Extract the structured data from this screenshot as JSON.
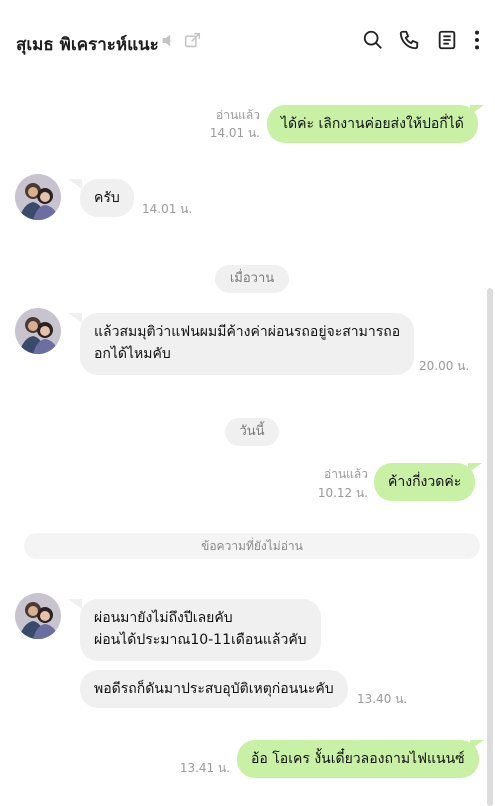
{
  "header": {
    "title": "สุเมธ พิเคราะห์แนะ"
  },
  "messages": {
    "m1": {
      "text": "ได้ค่ะ เลิกงานค่อยส่งให้ปอกี่ได้",
      "status": "อ่านแล้ว",
      "time": "14.01 น."
    },
    "m2": {
      "text": "ครับ",
      "time": "14.01 น."
    },
    "m3": {
      "text_line1": "แล้วสมมุติว่าแฟนผมมีค้างค่าผ่อนรถอยู่จะสามารถอ",
      "text_line2": "อกได้ไหมคับ",
      "time": "20.00 น."
    },
    "m4": {
      "text": "ค้างกี่งวดค่ะ",
      "status": "อ่านแล้ว",
      "time": "10.12 น."
    },
    "m5": {
      "text_line1": "ผ่อนมายังไม่ถึงปีเลยคับ",
      "text_line2": "ผ่อนได้ประมาณ10-11เดือนแล้วคับ"
    },
    "m6": {
      "text": "พอดีรถก็ดันมาประสบอุบัติเหตุก่อนนะคับ",
      "time": "13.40 น."
    },
    "m7": {
      "text": "อ้อ โอเคร งั้นเดี๋ยวลองถามไฟแนนซ์",
      "time": "13.41 น."
    }
  },
  "dates": {
    "yesterday": "เมื่อวาน",
    "today": "วันนี้"
  },
  "unread_label": "ข้อความที่ยังไม่อ่าน",
  "colors": {
    "outgoing_bubble": "#c9f1a6",
    "incoming_bubble": "#f0f0f0"
  },
  "icons": [
    "mute-icon",
    "external-link-icon",
    "search-icon",
    "phone-icon",
    "notes-icon",
    "more-vertical-icon"
  ]
}
